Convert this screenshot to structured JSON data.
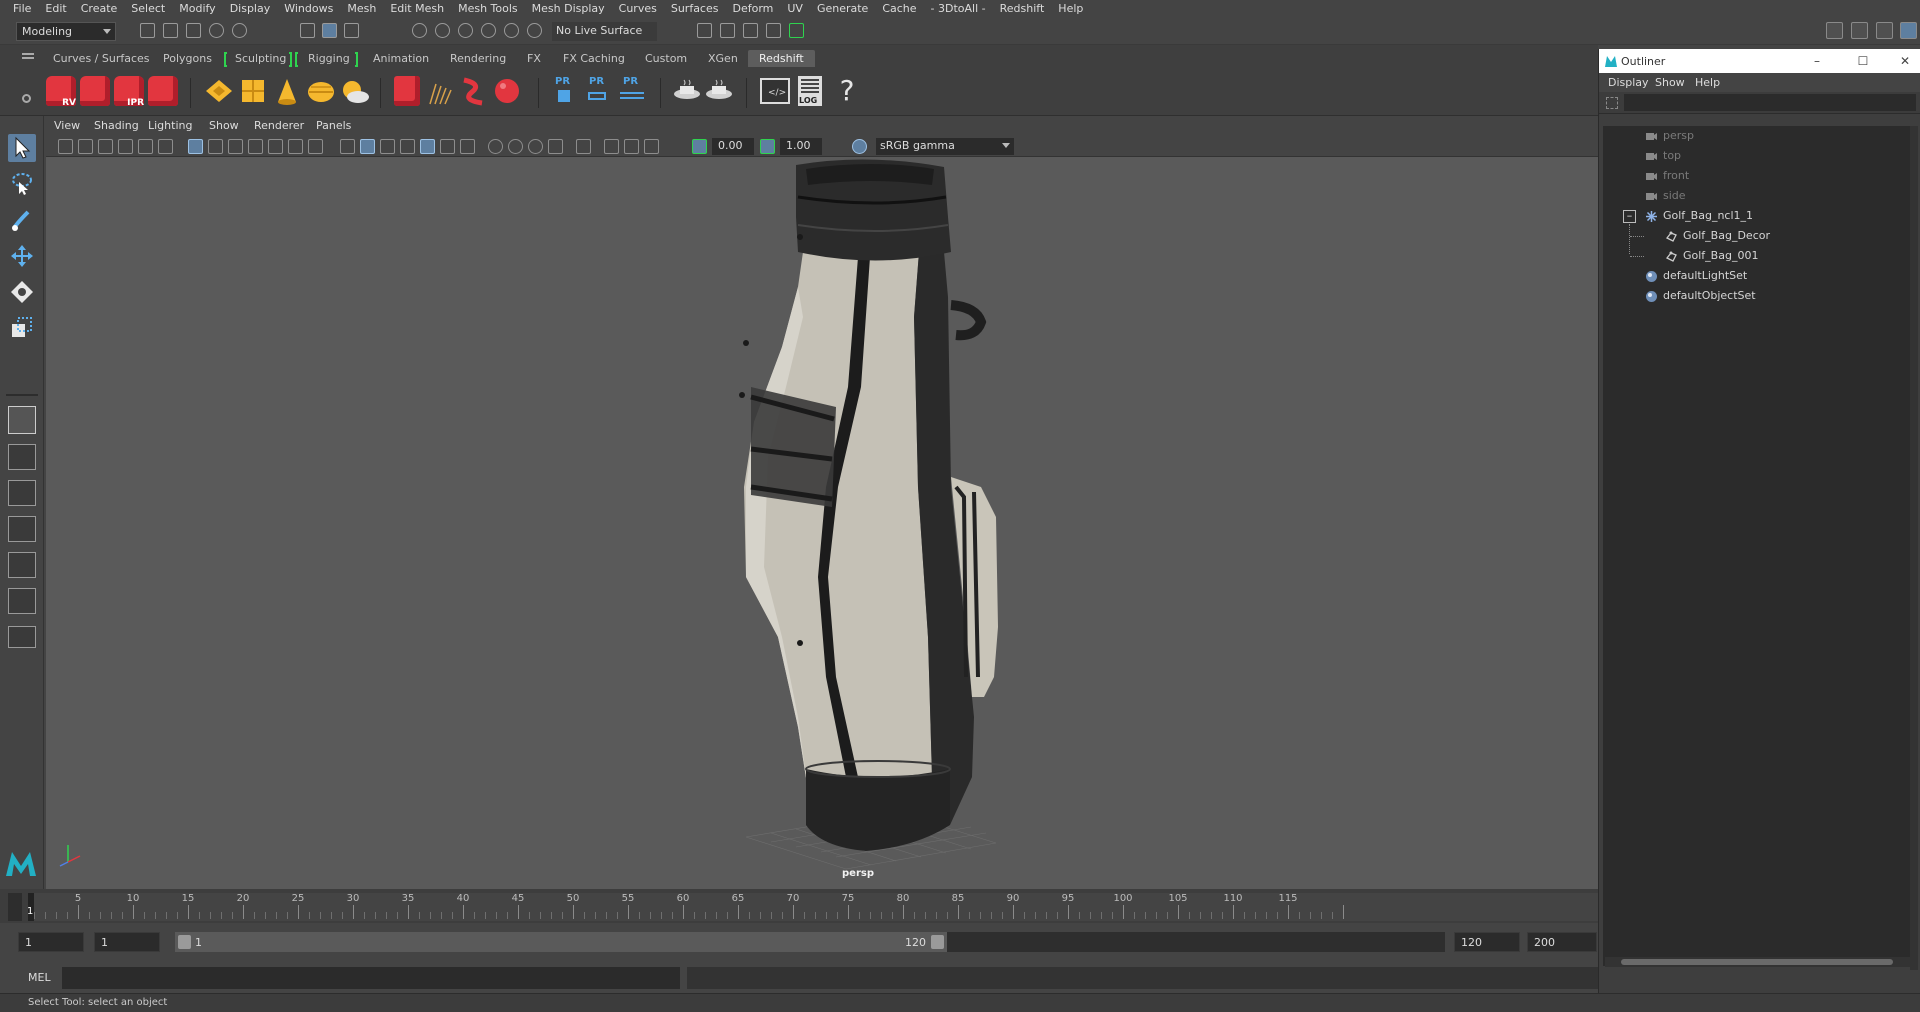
{
  "menubar": [
    "File",
    "Edit",
    "Create",
    "Select",
    "Modify",
    "Display",
    "Windows",
    "Mesh",
    "Edit Mesh",
    "Mesh Tools",
    "Mesh Display",
    "Curves",
    "Surfaces",
    "Deform",
    "UV",
    "Generate",
    "Cache",
    "- 3DtoAll -",
    "Redshift",
    "Help"
  ],
  "statusline": {
    "mode": "Modeling",
    "live_surface": "No Live Surface"
  },
  "shelf_tabs": [
    "Curves / Surfaces",
    "Polygons",
    "Sculpting",
    "Rigging",
    "Animation",
    "Rendering",
    "FX",
    "FX Caching",
    "Custom",
    "XGen",
    "Redshift"
  ],
  "active_shelf_tab": "Redshift",
  "shelf_icon_labels": {
    "rv": "RV",
    "ipr": "IPR",
    "pr": "PR",
    "log": "LOG",
    "help": "?"
  },
  "viewport_menu": [
    "View",
    "Shading",
    "Lighting",
    "Show",
    "Renderer",
    "Panels"
  ],
  "viewport_toolbar": {
    "exposure": "0.00",
    "gamma_value": "1.00",
    "color_space": "sRGB gamma"
  },
  "viewport": {
    "camera_label": "persp"
  },
  "timeline": {
    "labels": [
      "5",
      "10",
      "15",
      "20",
      "25",
      "30",
      "35",
      "40",
      "45",
      "50",
      "55",
      "60",
      "65",
      "70",
      "75",
      "80",
      "85",
      "90",
      "95",
      "100",
      "105",
      "110",
      "115"
    ],
    "current_frame": "1"
  },
  "range": {
    "start_time": "1",
    "playback_start": "1",
    "slider_start": "1",
    "slider_end": "120",
    "playback_end": "120",
    "end_time": "200"
  },
  "command_line": {
    "label": "MEL"
  },
  "help_line": "Select Tool: select an object",
  "outliner": {
    "title": "Outliner",
    "menu": [
      "Display",
      "Show",
      "Help"
    ],
    "items": [
      {
        "label": "persp",
        "type": "camera"
      },
      {
        "label": "top",
        "type": "camera"
      },
      {
        "label": "front",
        "type": "camera"
      },
      {
        "label": "side",
        "type": "camera"
      },
      {
        "label": "Golf_Bag_ncl1_1",
        "type": "group"
      },
      {
        "label": "Golf_Bag_Decor",
        "type": "mesh"
      },
      {
        "label": "Golf_Bag_001",
        "type": "mesh"
      },
      {
        "label": "defaultLightSet",
        "type": "set"
      },
      {
        "label": "defaultObjectSet",
        "type": "set"
      }
    ]
  },
  "colors": {
    "accent_green": "#2fd34f",
    "redshift_red": "#e2363f",
    "selection_blue": "#5e7fa0"
  }
}
